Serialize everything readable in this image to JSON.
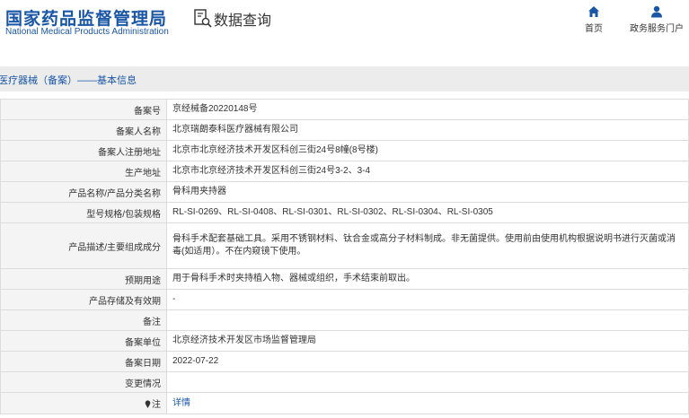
{
  "header": {
    "logo_cn": "国家药品监督管理局",
    "logo_en": "National Medical Products Administration",
    "query_label": "数据查询",
    "nav": {
      "home": "首页",
      "portal": "政务服务门户"
    }
  },
  "section": {
    "title": "医疗器械（备案）——基本信息"
  },
  "rows": [
    {
      "key": "备案号",
      "value": "京经械备20220148号"
    },
    {
      "key": "备案人名称",
      "value": "北京瑞朗泰科医疗器械有限公司"
    },
    {
      "key": "备案人注册地址",
      "value": "北京市北京经济技术开发区科创三街24号8幢(8号楼)"
    },
    {
      "key": "生产地址",
      "value": "北京市北京经济技术开发区科创三街24号3-2、3-4"
    },
    {
      "key": "产品名称/产品分类名称",
      "value": "骨科用夹持器"
    },
    {
      "key": "型号规格/包装规格",
      "value": "RL-SI-0269、RL-SI-0408、RL-SI-0301、RL-SI-0302、RL-SI-0304、RL-SI-0305"
    },
    {
      "key": "产品描述/主要组成成分",
      "value": "骨科手术配套基础工具。采用不锈钢材料、钛合金或高分子材料制成。非无菌提供。使用前由使用机构根据说明书进行灭菌或消毒(如适用）。不在内窥镜下使用。"
    },
    {
      "key": "预期用途",
      "value": "用于骨科手术时夹持植入物、器械或组织，手术结束前取出。"
    },
    {
      "key": "产品存储及有效期",
      "value": "-"
    },
    {
      "key": "备注",
      "value": ""
    },
    {
      "key": "备案单位",
      "value": "北京经济技术开发区市场监督管理局"
    },
    {
      "key": "备案日期",
      "value": "2022-07-22"
    },
    {
      "key": "变更情况",
      "value": ""
    },
    {
      "key": "注",
      "value": "详情"
    }
  ],
  "colors": {
    "brand_blue": "#1a56a6",
    "key_bg": "#f4f4f4",
    "bar_bg": "#ececec"
  }
}
